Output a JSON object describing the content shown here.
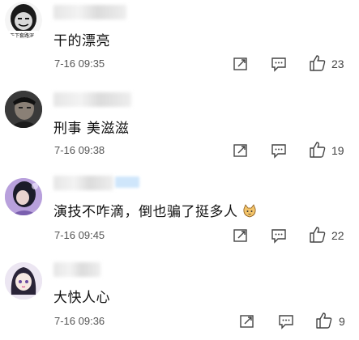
{
  "comments": [
    {
      "text": "干的漂亮",
      "time": "7-16 09:35",
      "likes": "23",
      "avatar_caption": "天下套路深",
      "icons": [
        "share-icon",
        "reply-icon",
        "like-icon"
      ]
    },
    {
      "text": "刑事 美滋滋",
      "time": "7-16 09:38",
      "likes": "19",
      "icons": [
        "share-icon",
        "reply-icon",
        "like-icon"
      ]
    },
    {
      "text": "演技不咋滴，倒也骗了挺多人",
      "time": "7-16 09:45",
      "likes": "22",
      "emoji": "cat-emoji",
      "icons": [
        "share-icon",
        "reply-icon",
        "like-icon"
      ]
    },
    {
      "text": "大快人心",
      "time": "7-16 09:36",
      "likes": "9",
      "icons": [
        "share-icon",
        "reply-icon",
        "like-icon"
      ]
    }
  ],
  "colors": {
    "icon": "#444444",
    "text": "#111111",
    "time": "#555555",
    "blur_badge": "#cfe6fb"
  }
}
